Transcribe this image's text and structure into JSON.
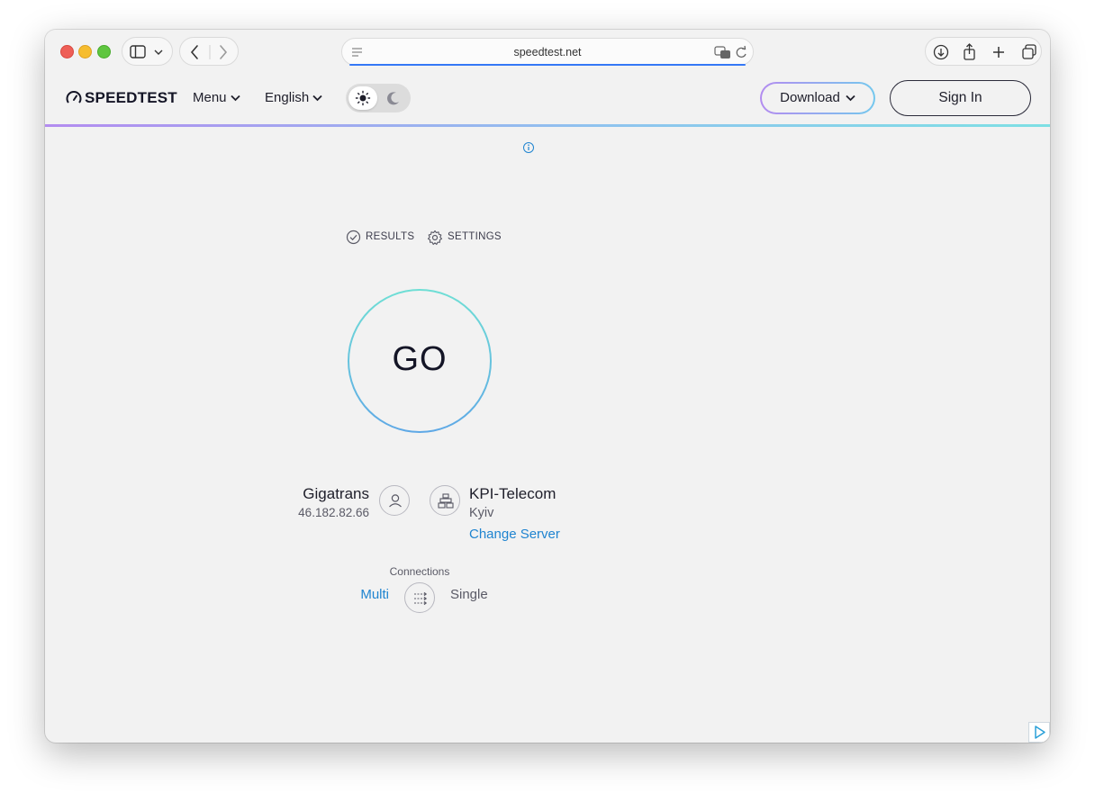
{
  "browser": {
    "url": "speedtest.net"
  },
  "site_nav": {
    "logo": "SPEEDTEST",
    "menu_label": "Menu",
    "language_label": "English",
    "download_label": "Download",
    "sign_in_label": "Sign In"
  },
  "test_panel": {
    "results_label": "RESULTS",
    "settings_label": "SETTINGS",
    "go_label": "GO",
    "provider": {
      "name": "Gigatrans",
      "ip": "46.182.82.66"
    },
    "server": {
      "name": "KPI-Telecom",
      "location": "Kyiv",
      "change_label": "Change Server"
    },
    "connections": {
      "label": "Connections",
      "multi_label": "Multi",
      "single_label": "Single",
      "selected": "Multi"
    }
  },
  "colors": {
    "accent_link": "#1f84d0",
    "go_ring_top": "#6fdfd5",
    "go_ring_bottom": "#5ea8e6",
    "download_border_left": "#b38cf0",
    "download_border_right": "#74c8ee",
    "progress_bar": "#3478f6"
  }
}
